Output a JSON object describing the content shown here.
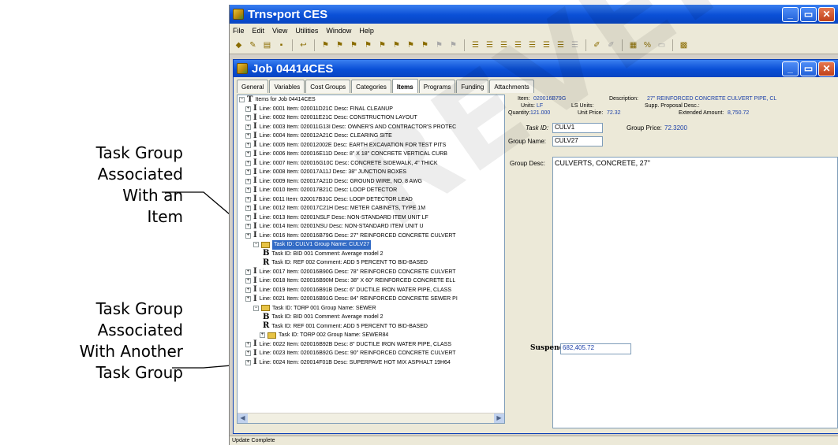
{
  "annotations": {
    "task_group_item": [
      "Task Group",
      "Associated",
      "With an",
      "Item"
    ],
    "task_group_group": [
      "Task Group",
      "Associated",
      "With Another",
      "Task Group"
    ]
  },
  "watermark": "REVERSE",
  "app": {
    "title": "Trns•port CES",
    "menu": [
      "File",
      "Edit",
      "View",
      "Utilities",
      "Window",
      "Help"
    ]
  },
  "job": {
    "title": "Job 04414CES",
    "tabs": [
      "General",
      "Variables",
      "Cost Groups",
      "Categories",
      "Items",
      "Programs",
      "Funding",
      "Attachments"
    ],
    "active_tab": "Items",
    "tree_root": "Items for Job 04414CES",
    "tree": [
      {
        "kind": "line",
        "text": "Line: 0001  Item: 020011D21C  Desc: FINAL CLEANUP"
      },
      {
        "kind": "line",
        "text": "Line: 0002  Item: 020011E21C  Desc: CONSTRUCTION LAYOUT"
      },
      {
        "kind": "line",
        "text": "Line: 0003  Item: 020011G13I  Desc: OWNER'S AND CONTRACTOR'S PROTEC"
      },
      {
        "kind": "line",
        "text": "Line: 0004  Item: 020012A21C  Desc: CLEARING SITE"
      },
      {
        "kind": "line",
        "text": "Line: 0005  Item: 020012002E  Desc: EARTH EXCAVATION FOR TEST PITS"
      },
      {
        "kind": "line",
        "text": "Line: 0006  Item: 020016E11D  Desc: 8\" X 18\" CONCRETE VERTICAL CURB"
      },
      {
        "kind": "line",
        "text": "Line: 0007  Item: 020016G10C  Desc: CONCRETE SIDEWALK, 4\" THICK"
      },
      {
        "kind": "line",
        "text": "Line: 0008  Item: 020017A11J  Desc: 38\" JUNCTION BOXES"
      },
      {
        "kind": "line",
        "text": "Line: 0009  Item: 020017A21D  Desc: GROUND WIRE, NO. 8 AWG"
      },
      {
        "kind": "line",
        "text": "Line: 0010  Item: 020017B21C  Desc: LOOP DETECTOR"
      },
      {
        "kind": "line",
        "text": "Line: 0011  Item: 020017B31C  Desc: LOOP DETECTOR LEAD"
      },
      {
        "kind": "line",
        "text": "Line: 0012  Item: 020017C21H  Desc: METER CABINETS, TYPE 1M"
      },
      {
        "kind": "line",
        "text": "Line: 0013  Item: 02001NSLF  Desc: NON-STANDARD ITEM UNIT LF"
      },
      {
        "kind": "line",
        "text": "Line: 0014  Item: 02001NSU  Desc: NON-STANDARD ITEM UNIT U"
      },
      {
        "kind": "line",
        "text": "Line: 0016  Item: 020016B79G  Desc: 27\" REINFORCED CONCRETE CULVERT"
      },
      {
        "kind": "group",
        "selected": true,
        "text": "Task ID: CULV1  Group Name: CULV27"
      },
      {
        "kind": "bid",
        "text": "Task ID: BID 001  Comment: Average model 2"
      },
      {
        "kind": "ref",
        "text": "Task ID: REF 002  Comment: ADD 5 PERCENT TO BID-BASED"
      },
      {
        "kind": "line",
        "text": "Line: 0017  Item: 020016B90G  Desc: 78\" REINFORCED CONCRETE CULVERT"
      },
      {
        "kind": "line",
        "text": "Line: 0018  Item: 020016B90M  Desc: 38\" X 60\" REINFORCED CONCRETE ELL"
      },
      {
        "kind": "line",
        "text": "Line: 0019  Item: 020016B91B  Desc: 6\" DUCTILE IRON WATER PIPE, CLASS"
      },
      {
        "kind": "line",
        "text": "Line: 0021  Item: 020016B91G  Desc: 84\" REINFORCED CONCRETE SEWER PI"
      },
      {
        "kind": "group",
        "text": "Task ID: TORP 001  Group Name: SEWER"
      },
      {
        "kind": "bid",
        "text": "Task ID: BID 001  Comment: Average model 2"
      },
      {
        "kind": "ref",
        "text": "Task ID: REF 001  Comment: ADD 5 PERCENT TO BID-BASED"
      },
      {
        "kind": "subgroup",
        "text": "Task ID: TORP 002  Group Name: SEWER84"
      },
      {
        "kind": "line",
        "text": "Line: 0022  Item: 020016B92B  Desc: 8\" DUCTILE IRON WATER PIPE, CLASS"
      },
      {
        "kind": "line",
        "text": "Line: 0023  Item: 020016B92G  Desc: 90\" REINFORCED CONCRETE CULVERT"
      },
      {
        "kind": "line",
        "text": "Line: 0024  Item: 020014F01B  Desc: SUPERPAVE HOT MIX ASPHALT 19H64"
      }
    ],
    "detail": {
      "item_label": "Item:",
      "item_value": "020016B79G",
      "desc_label": "Description:",
      "desc_value": "27\" REINFORCED CONCRETE CULVERT PIPE, CL",
      "units_label": "Units:",
      "units_value": "LF",
      "ls_units_label": "LS Units:",
      "supp_label": "Supp. Proposal Desc.:",
      "quantity_label": "Quantity:",
      "quantity_value": "121.000",
      "unit_price_label": "Unit Price:",
      "unit_price_value": "72.32",
      "extended_label": "Extended Amount:",
      "extended_value": "8,750.72",
      "task_id_label": "Task ID:",
      "task_id_value": "CULV1",
      "group_price_label": "Group Price:",
      "group_price_value": "72.3200",
      "group_name_label": "Group Name:",
      "group_name_value": "CULV27",
      "group_desc_label": "Group Desc:",
      "group_desc_value": "CULVERTS, CONCRETE, 27\"",
      "suspend_label": "Suspend",
      "suspend_value": "682,405.72"
    },
    "status": "Update Complete"
  }
}
